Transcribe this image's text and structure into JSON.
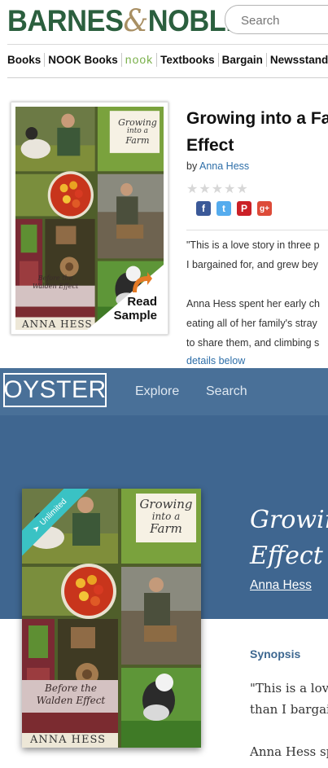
{
  "bn": {
    "logo_left": "BARNES",
    "logo_amp": "&",
    "logo_right": "NOBLE",
    "search_placeholder": "Search",
    "nav": [
      "Books",
      "NOOK Books",
      "nook",
      "Textbooks",
      "Bargain",
      "Newsstand"
    ],
    "title_line1": "Growing into a Fa",
    "title_line2": "Effect",
    "by_label": "by",
    "author": "Anna Hess",
    "social": [
      "f",
      "t",
      "P",
      "g+"
    ],
    "text_lines": [
      "\"This is a love story in three p",
      "I bargained for, and grew bey",
      "",
      "Anna Hess spent her early ch",
      "eating all of her family's stray",
      "to share them, and climbing s"
    ],
    "details_link": "details below",
    "read_sample_line1": "Read",
    "read_sample_line2": "Sample"
  },
  "cover": {
    "title_line1": "Growing",
    "title_line2": "into a",
    "title_line3": "Farm",
    "subtitle_line1": "Before the",
    "subtitle_line2": "Walden Effect",
    "author": "ANNA HESS"
  },
  "oyster": {
    "logo": "OYSTER",
    "nav_explore": "Explore",
    "nav_search": "Search",
    "badge": "Unlimited",
    "title_line1": "Growin",
    "title_line2": "Effect (",
    "author": "Anna Hess",
    "synopsis_label": "Synopsis",
    "quote_line1": "\"This is a lov",
    "quote_line2": "than I bargai",
    "para_start": "Anna Hess sp"
  },
  "colors": {
    "bn_green": "#2b5f3e",
    "bn_link": "#2d6ea8",
    "oyster_header": "#497098",
    "oyster_hero": "#3f6690",
    "oyster_badge": "#3ac2c4"
  }
}
